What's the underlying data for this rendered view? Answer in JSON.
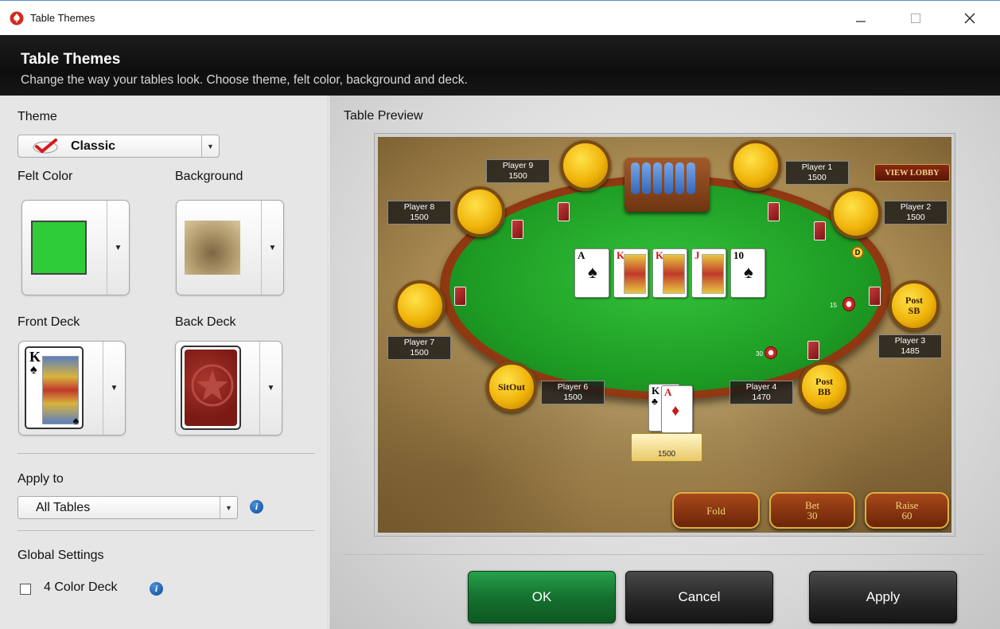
{
  "window": {
    "title": "Table Themes",
    "icons": [
      "spade-logo-icon",
      "minimize-icon",
      "maximize-icon",
      "close-icon"
    ]
  },
  "header": {
    "title": "Table Themes",
    "subtitle": "Change the way your tables look. Choose theme, felt color, background and deck."
  },
  "left": {
    "theme_label": "Theme",
    "theme_value": "Classic",
    "felt_color_label": "Felt Color",
    "felt_color": "#2ecc37",
    "background_label": "Background",
    "front_deck_label": "Front Deck",
    "back_deck_label": "Back Deck",
    "apply_to_label": "Apply to",
    "apply_to_value": "All Tables",
    "global_settings_label": "Global Settings",
    "four_color_deck_label": "4 Color Deck",
    "four_color_deck_checked": false
  },
  "preview": {
    "label": "Table Preview",
    "view_lobby": "VIEW LOBBY",
    "players": [
      {
        "name": "Player 9",
        "stack": "1500"
      },
      {
        "name": "Player 1",
        "stack": "1500"
      },
      {
        "name": "Player 8",
        "stack": "1500"
      },
      {
        "name": "Player 2",
        "stack": "1500"
      },
      {
        "name": "Player 7",
        "stack": "1500"
      },
      {
        "name": "Player 3",
        "stack": "1485"
      },
      {
        "name": "Player 6",
        "stack": "1500"
      },
      {
        "name": "Player 4",
        "stack": "1470"
      }
    ],
    "seat_sitout": "SitOut",
    "seat_post_sb": "Post SB",
    "seat_post_bb": "Post BB",
    "bet_sb": "15",
    "bet_bb": "30",
    "dealer_button": "D",
    "board": [
      {
        "rank": "A",
        "suit": "♠"
      },
      {
        "rank": "K",
        "suit": "♥"
      },
      {
        "rank": "K",
        "suit": "♦"
      },
      {
        "rank": "J",
        "suit": "♦"
      },
      {
        "rank": "10",
        "suit": "♠"
      }
    ],
    "hero_cards": [
      {
        "rank": "K",
        "suit": "♣"
      },
      {
        "rank": "A",
        "suit": "♦"
      }
    ],
    "hero_stack": "1500",
    "fold": "Fold",
    "bet": "Bet",
    "bet_amount": "30",
    "raise": "Raise",
    "raise_amount": "60"
  },
  "buttons": {
    "ok": "OK",
    "cancel": "Cancel",
    "apply": "Apply"
  }
}
